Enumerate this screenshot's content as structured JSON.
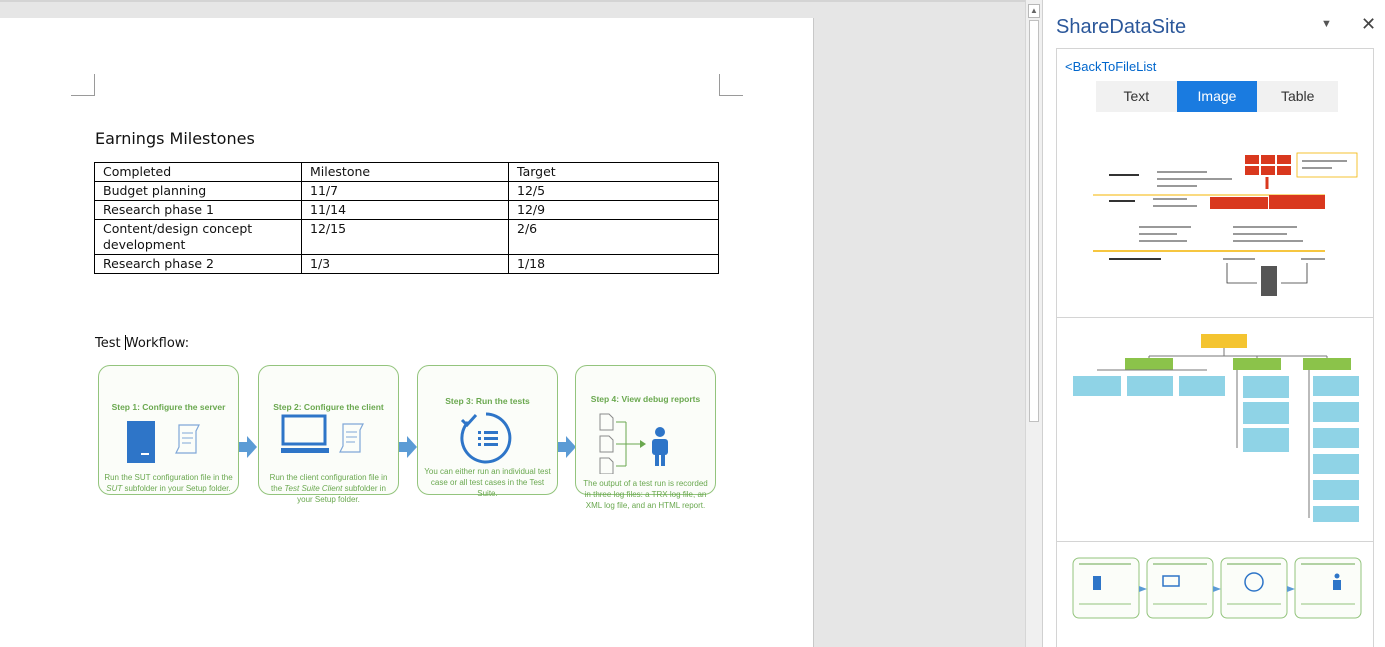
{
  "document": {
    "heading": "Earnings Milestones",
    "table": {
      "headers": [
        "Completed",
        "Milestone",
        "Target"
      ],
      "rows": [
        [
          "Budget planning",
          "11/7",
          "12/5"
        ],
        [
          "Research phase 1",
          "11/14",
          "12/9"
        ],
        [
          "Content/design concept development",
          "12/15",
          "2/6"
        ],
        [
          "Research phase 2",
          "1/3",
          "1/18"
        ]
      ]
    },
    "workflow_label_before": "Test ",
    "workflow_label_after": "Workflow:",
    "steps": [
      {
        "title": "Step 1: Configure the server",
        "desc_a": "Run the SUT configuration file in the ",
        "desc_em": "SUT",
        "desc_b": " subfolder in your   Setup   folder."
      },
      {
        "title": "Step 2: Configure the client",
        "desc_a": "Run the client configuration file in the ",
        "desc_em": "Test Suite Client",
        "desc_b": " subfolder in your   Setup   folder."
      },
      {
        "title": "Step 3: Run the tests",
        "desc_a": "You can either run an individual test case or all test cases in the Test Suite.",
        "desc_em": "",
        "desc_b": ""
      },
      {
        "title": "Step 4: View debug reports",
        "desc_a": "The output of a test run is recorded in three log files: a TRX log file, an XML log file, and an HTML report.",
        "desc_em": "",
        "desc_b": ""
      }
    ],
    "colors": {
      "step_green": "#6aa84f",
      "arrow_blue": "#5b9bd5",
      "icon_blue": "#2e75c8"
    }
  },
  "pane": {
    "title": "ShareDataSite",
    "dropdown_icon": "chevron-down-icon",
    "close_icon": "close-icon",
    "back_link": "<BackToFileList",
    "tabs": [
      "Text",
      "Image",
      "Table"
    ],
    "active_tab": "Image",
    "thumbnails": [
      "architecture-diagram",
      "org-chart-diagram",
      "test-workflow-diagram"
    ],
    "colors": {
      "title": "#2b579a",
      "active_tab": "#1a7be0",
      "link": "#0066cc"
    }
  }
}
